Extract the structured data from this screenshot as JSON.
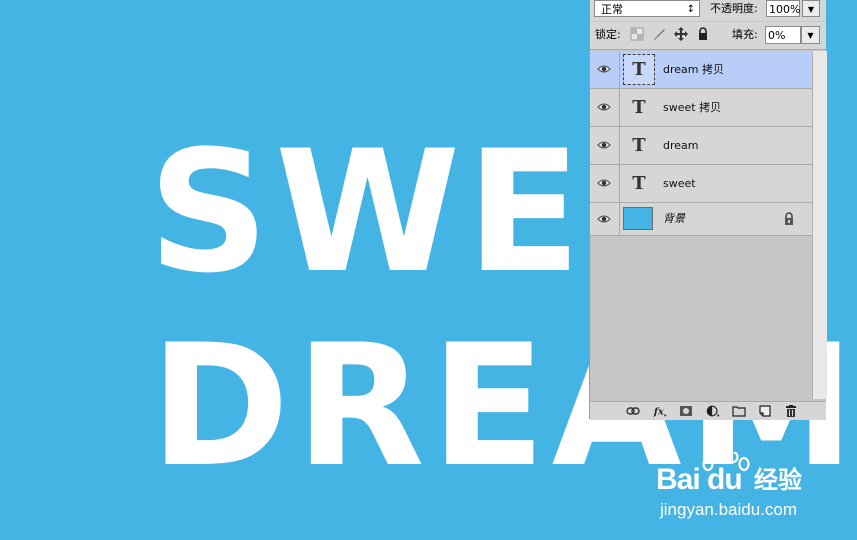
{
  "canvas": {
    "line1": "SWEET",
    "line2": "DREAM",
    "background": "#44b4e4",
    "text_color": "#ffffff"
  },
  "layers_panel": {
    "blend_mode": "正常",
    "opacity_label": "不透明度:",
    "opacity_value": "100%",
    "lock_label": "锁定:",
    "fill_label": "填充:",
    "fill_value": "0%",
    "layers": [
      {
        "name": "dream 拷贝",
        "kind": "text",
        "thumb": "T",
        "selected": true
      },
      {
        "name": "sweet 拷贝",
        "kind": "text",
        "thumb": "T",
        "selected": false
      },
      {
        "name": "dream",
        "kind": "text",
        "thumb": "T",
        "selected": false
      },
      {
        "name": "sweet",
        "kind": "text",
        "thumb": "T",
        "selected": false
      },
      {
        "name": "背景",
        "kind": "background",
        "locked": true
      }
    ],
    "footer_icons": [
      "link-icon",
      "fx-icon",
      "mask-icon",
      "adjustment-icon",
      "folder-icon",
      "new-layer-icon",
      "trash-icon"
    ],
    "selected_color": "#b8cdf8"
  },
  "watermark": {
    "logo": "Bai du",
    "cn": "经验",
    "url": "jingyan.baidu.com"
  }
}
